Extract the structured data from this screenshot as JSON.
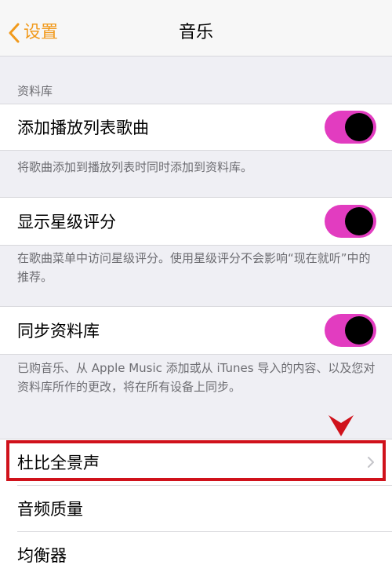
{
  "navbar": {
    "back_label": "设置",
    "title": "音乐"
  },
  "library_section": {
    "header": "资料库",
    "items": [
      {
        "label": "添加播放列表歌曲",
        "toggle_on": true,
        "footer": "将歌曲添加到播放列表时同时添加到资料库。"
      },
      {
        "label": "显示星级评分",
        "toggle_on": true,
        "footer": "在歌曲菜单中访问星级评分。使用星级评分不会影响“现在就听”中的推荐。"
      },
      {
        "label": "同步资料库",
        "toggle_on": true,
        "footer": "已购音乐、从 Apple Music 添加或从 iTunes 导入的内容、以及您对资料库所作的更改，将在所有设备上同步。"
      }
    ]
  },
  "audio_section": {
    "items": [
      {
        "label": "杜比全景声",
        "highlighted": true
      },
      {
        "label": "音频质量"
      },
      {
        "label": "均衡器"
      }
    ]
  },
  "colors": {
    "accent": "#f19a1c",
    "toggle_track": "#e23cc0",
    "toggle_knob": "#000000",
    "highlight": "#d0121b",
    "background": "#efeff4"
  },
  "icons": [
    "back-chevron-icon",
    "chevron-right-icon",
    "down-arrow-marker"
  ]
}
